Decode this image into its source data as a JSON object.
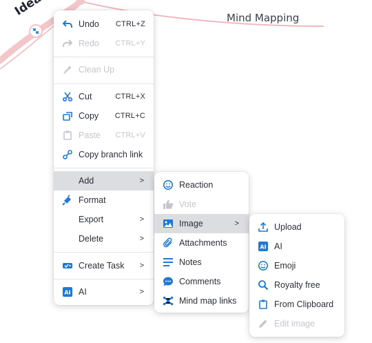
{
  "mindmap": {
    "central_topic": "Ideas",
    "branch_topic": "Mind Mapping",
    "branch_color": "#f1b8bd"
  },
  "colors": {
    "icon_blue": "#1e78d6",
    "disabled": "#c3c6cd",
    "highlight": "#dcdde0"
  },
  "main_menu": {
    "undo": {
      "label": "Undo",
      "shortcut": "CTRL+Z",
      "icon": "undo-icon"
    },
    "redo": {
      "label": "Redo",
      "shortcut": "CTRL+Y",
      "icon": "redo-icon"
    },
    "cleanup": {
      "label": "Clean Up",
      "icon": "magic-wand-icon"
    },
    "cut": {
      "label": "Cut",
      "shortcut": "CTRL+X",
      "icon": "scissors-icon"
    },
    "copy": {
      "label": "Copy",
      "shortcut": "CTRL+C",
      "icon": "copy-icon"
    },
    "paste": {
      "label": "Paste",
      "shortcut": "CTRL+V",
      "icon": "clipboard-icon"
    },
    "copy_link": {
      "label": "Copy branch link",
      "icon": "link-icon"
    },
    "add": {
      "label": "Add",
      "arrow": ">"
    },
    "format": {
      "label": "Format",
      "icon": "paint-bucket-icon"
    },
    "export": {
      "label": "Export",
      "arrow": ">"
    },
    "delete": {
      "label": "Delete",
      "arrow": ">"
    },
    "create_task": {
      "label": "Create Task",
      "arrow": ">",
      "icon": "task-icon"
    },
    "ai": {
      "label": "AI",
      "arrow": ">",
      "icon": "ai-icon"
    }
  },
  "add_menu": {
    "reaction": {
      "label": "Reaction",
      "icon": "smiley-icon"
    },
    "vote": {
      "label": "Vote",
      "icon": "thumbs-up-icon"
    },
    "image": {
      "label": "Image",
      "arrow": ">",
      "icon": "image-icon"
    },
    "attachments": {
      "label": "Attachments",
      "icon": "paperclip-icon"
    },
    "notes": {
      "label": "Notes",
      "icon": "notes-icon"
    },
    "comments": {
      "label": "Comments",
      "icon": "comment-icon"
    },
    "links": {
      "label": "Mind map links",
      "icon": "network-icon"
    }
  },
  "image_menu": {
    "upload": {
      "label": "Upload",
      "icon": "upload-icon"
    },
    "ai": {
      "label": "AI",
      "icon": "ai-icon"
    },
    "emoji": {
      "label": "Emoji",
      "icon": "smiley-icon"
    },
    "royalty_free": {
      "label": "Royalty free",
      "icon": "search-icon"
    },
    "clipboard": {
      "label": "From Clipboard",
      "icon": "clipboard-icon"
    },
    "edit": {
      "label": "Edit image",
      "icon": "pencil-icon"
    }
  }
}
